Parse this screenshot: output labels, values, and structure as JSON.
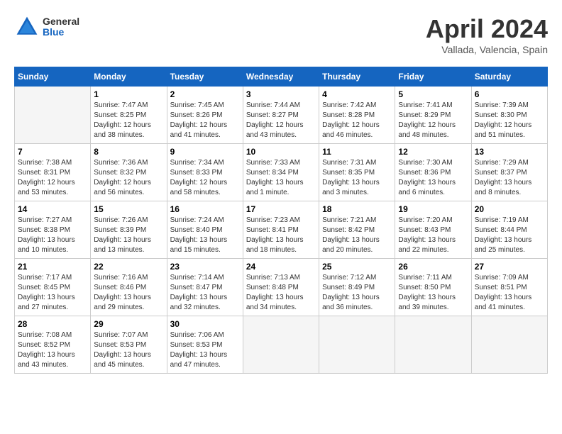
{
  "header": {
    "logo": {
      "general": "General",
      "blue": "Blue"
    },
    "title": "April 2024",
    "location": "Vallada, Valencia, Spain"
  },
  "weekdays": [
    "Sunday",
    "Monday",
    "Tuesday",
    "Wednesday",
    "Thursday",
    "Friday",
    "Saturday"
  ],
  "weeks": [
    [
      {
        "day": "",
        "sunrise": "",
        "sunset": "",
        "daylight": "",
        "empty": true
      },
      {
        "day": "1",
        "sunrise": "7:47 AM",
        "sunset": "8:25 PM",
        "daylight": "12 hours and 38 minutes."
      },
      {
        "day": "2",
        "sunrise": "7:45 AM",
        "sunset": "8:26 PM",
        "daylight": "12 hours and 41 minutes."
      },
      {
        "day": "3",
        "sunrise": "7:44 AM",
        "sunset": "8:27 PM",
        "daylight": "12 hours and 43 minutes."
      },
      {
        "day": "4",
        "sunrise": "7:42 AM",
        "sunset": "8:28 PM",
        "daylight": "12 hours and 46 minutes."
      },
      {
        "day": "5",
        "sunrise": "7:41 AM",
        "sunset": "8:29 PM",
        "daylight": "12 hours and 48 minutes."
      },
      {
        "day": "6",
        "sunrise": "7:39 AM",
        "sunset": "8:30 PM",
        "daylight": "12 hours and 51 minutes."
      }
    ],
    [
      {
        "day": "7",
        "sunrise": "7:38 AM",
        "sunset": "8:31 PM",
        "daylight": "12 hours and 53 minutes."
      },
      {
        "day": "8",
        "sunrise": "7:36 AM",
        "sunset": "8:32 PM",
        "daylight": "12 hours and 56 minutes."
      },
      {
        "day": "9",
        "sunrise": "7:34 AM",
        "sunset": "8:33 PM",
        "daylight": "12 hours and 58 minutes."
      },
      {
        "day": "10",
        "sunrise": "7:33 AM",
        "sunset": "8:34 PM",
        "daylight": "13 hours and 1 minute."
      },
      {
        "day": "11",
        "sunrise": "7:31 AM",
        "sunset": "8:35 PM",
        "daylight": "13 hours and 3 minutes."
      },
      {
        "day": "12",
        "sunrise": "7:30 AM",
        "sunset": "8:36 PM",
        "daylight": "13 hours and 6 minutes."
      },
      {
        "day": "13",
        "sunrise": "7:29 AM",
        "sunset": "8:37 PM",
        "daylight": "13 hours and 8 minutes."
      }
    ],
    [
      {
        "day": "14",
        "sunrise": "7:27 AM",
        "sunset": "8:38 PM",
        "daylight": "13 hours and 10 minutes."
      },
      {
        "day": "15",
        "sunrise": "7:26 AM",
        "sunset": "8:39 PM",
        "daylight": "13 hours and 13 minutes."
      },
      {
        "day": "16",
        "sunrise": "7:24 AM",
        "sunset": "8:40 PM",
        "daylight": "13 hours and 15 minutes."
      },
      {
        "day": "17",
        "sunrise": "7:23 AM",
        "sunset": "8:41 PM",
        "daylight": "13 hours and 18 minutes."
      },
      {
        "day": "18",
        "sunrise": "7:21 AM",
        "sunset": "8:42 PM",
        "daylight": "13 hours and 20 minutes."
      },
      {
        "day": "19",
        "sunrise": "7:20 AM",
        "sunset": "8:43 PM",
        "daylight": "13 hours and 22 minutes."
      },
      {
        "day": "20",
        "sunrise": "7:19 AM",
        "sunset": "8:44 PM",
        "daylight": "13 hours and 25 minutes."
      }
    ],
    [
      {
        "day": "21",
        "sunrise": "7:17 AM",
        "sunset": "8:45 PM",
        "daylight": "13 hours and 27 minutes."
      },
      {
        "day": "22",
        "sunrise": "7:16 AM",
        "sunset": "8:46 PM",
        "daylight": "13 hours and 29 minutes."
      },
      {
        "day": "23",
        "sunrise": "7:14 AM",
        "sunset": "8:47 PM",
        "daylight": "13 hours and 32 minutes."
      },
      {
        "day": "24",
        "sunrise": "7:13 AM",
        "sunset": "8:48 PM",
        "daylight": "13 hours and 34 minutes."
      },
      {
        "day": "25",
        "sunrise": "7:12 AM",
        "sunset": "8:49 PM",
        "daylight": "13 hours and 36 minutes."
      },
      {
        "day": "26",
        "sunrise": "7:11 AM",
        "sunset": "8:50 PM",
        "daylight": "13 hours and 39 minutes."
      },
      {
        "day": "27",
        "sunrise": "7:09 AM",
        "sunset": "8:51 PM",
        "daylight": "13 hours and 41 minutes."
      }
    ],
    [
      {
        "day": "28",
        "sunrise": "7:08 AM",
        "sunset": "8:52 PM",
        "daylight": "13 hours and 43 minutes."
      },
      {
        "day": "29",
        "sunrise": "7:07 AM",
        "sunset": "8:53 PM",
        "daylight": "13 hours and 45 minutes."
      },
      {
        "day": "30",
        "sunrise": "7:06 AM",
        "sunset": "8:53 PM",
        "daylight": "13 hours and 47 minutes."
      },
      {
        "day": "",
        "sunrise": "",
        "sunset": "",
        "daylight": "",
        "empty": true
      },
      {
        "day": "",
        "sunrise": "",
        "sunset": "",
        "daylight": "",
        "empty": true
      },
      {
        "day": "",
        "sunrise": "",
        "sunset": "",
        "daylight": "",
        "empty": true
      },
      {
        "day": "",
        "sunrise": "",
        "sunset": "",
        "daylight": "",
        "empty": true
      }
    ]
  ]
}
